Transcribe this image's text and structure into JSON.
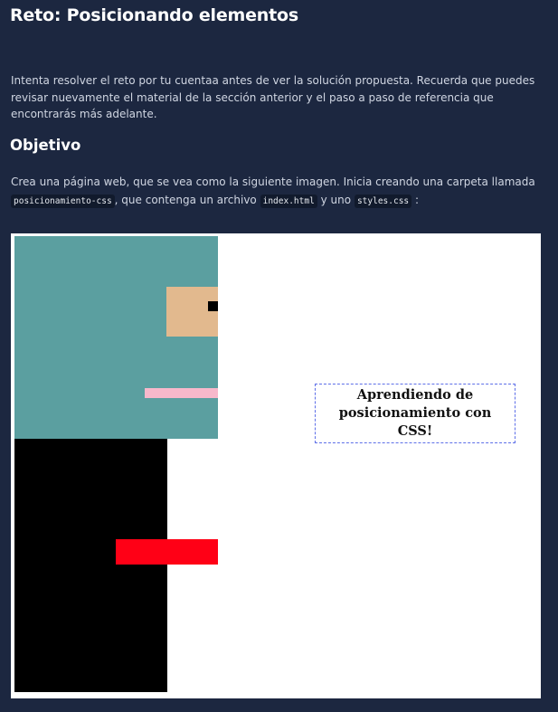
{
  "header": {
    "title": "Reto: Posicionando elementos"
  },
  "intro": {
    "text": "Intenta resolver el reto por tu cuentaa antes de ver la solución propuesta. Recuerda que puedes revisar nuevamente el material de la sección anterior y el paso a paso de referencia que encontrarás más adelante."
  },
  "objective": {
    "heading": "Objetivo",
    "text_1": "Crea una página web, que se vea como la siguiente imagen. Inicia creando una carpeta llamada",
    "code_folder": "posicionamiento-css",
    "text_2": ", que contenga un archivo",
    "code_html": "index.html",
    "text_3": "y uno",
    "code_css": "styles.css",
    "text_4": ":"
  },
  "figure": {
    "caption": "Aprendiendo de posicionamiento con CSS!",
    "colors": {
      "head": "#5b9fa0",
      "face": "#e2b98e",
      "eye": "#000000",
      "mouth": "#f7b8cb",
      "body": "#000000",
      "arm": "#ff0016",
      "caption_border": "#5d6fe8"
    }
  }
}
